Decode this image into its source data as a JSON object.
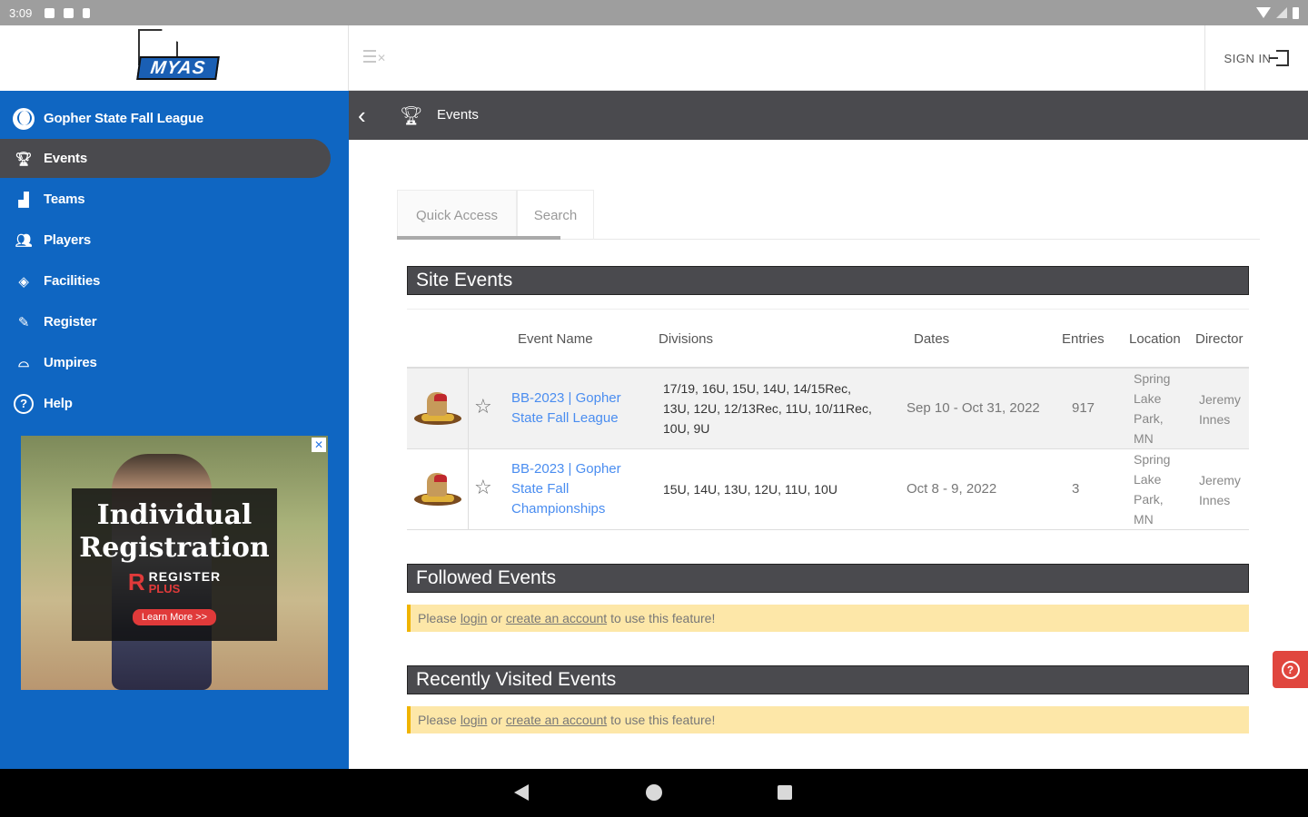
{
  "status_bar": {
    "time": "3:09"
  },
  "header": {
    "logo_text": "MYAS",
    "sign_in_label": "SIGN IN"
  },
  "sidebar": {
    "items": [
      {
        "label": "Gopher State Fall League",
        "icon": "baseball-icon"
      },
      {
        "label": "Events",
        "icon": "trophy-icon"
      },
      {
        "label": "Teams",
        "icon": "teams-icon"
      },
      {
        "label": "Players",
        "icon": "players-icon"
      },
      {
        "label": "Facilities",
        "icon": "facility-icon"
      },
      {
        "label": "Register",
        "icon": "register-icon"
      },
      {
        "label": "Umpires",
        "icon": "umpire-icon"
      },
      {
        "label": "Help",
        "icon": "help-icon"
      }
    ],
    "ad": {
      "line1": "Individual",
      "line2": "Registration",
      "brand_top": "REGISTER",
      "brand_bottom": "PLUS",
      "button": "Learn More >>"
    }
  },
  "subheader": {
    "title": "Events"
  },
  "tabs": [
    {
      "label": "Quick Access"
    },
    {
      "label": "Search"
    }
  ],
  "sections": {
    "site_events": "Site Events",
    "followed_events": "Followed Events",
    "recently_visited": "Recently Visited Events"
  },
  "table": {
    "headers": [
      "Event Name",
      "Divisions",
      "Dates",
      "Entries",
      "Location",
      "Director"
    ],
    "rows": [
      {
        "name_lines": [
          "BB-2023 | Gopher",
          "State Fall League"
        ],
        "divisions_lines": [
          "17/19, 16U, 15U, 14U, 14/15Rec,",
          "13U, 12U, 12/13Rec, 11U, 10/11Rec,",
          "10U, 9U"
        ],
        "dates": "Sep 10 - Oct 31, 2022",
        "entries": "917",
        "location_lines": [
          "Spring",
          "Lake",
          "Park,",
          "MN"
        ],
        "director_lines": [
          "Jeremy",
          "Innes"
        ]
      },
      {
        "name_lines": [
          "BB-2023 | Gopher",
          "State Fall",
          "Championships"
        ],
        "divisions_lines": [
          "15U, 14U, 13U, 12U, 11U, 10U"
        ],
        "dates": "Oct 8 - 9, 2022",
        "entries": "3",
        "location_lines": [
          "Spring",
          "Lake",
          "Park,",
          "MN"
        ],
        "director_lines": [
          "Jeremy",
          "Innes"
        ]
      }
    ]
  },
  "notice": {
    "prefix": "Please",
    "login": "login",
    "or": "or",
    "create": "create an account",
    "suffix": "to use this feature!"
  }
}
